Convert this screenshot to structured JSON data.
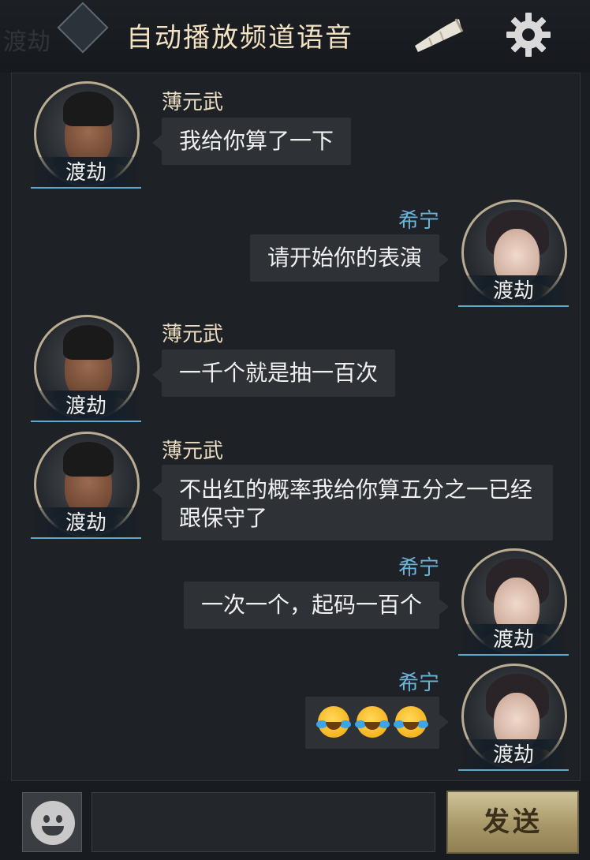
{
  "header": {
    "title": "自动播放频道语音",
    "ghost_left": "渡劫",
    "horn_icon": "horn-icon",
    "settings_icon": "gear-icon"
  },
  "messages": [
    {
      "side": "left",
      "sender": "薄元武",
      "tag": "渡劫",
      "text": "我给你算了一下",
      "avatar": "male"
    },
    {
      "side": "right",
      "sender": "希宁",
      "tag": "渡劫",
      "text": "请开始你的表演",
      "avatar": "female"
    },
    {
      "side": "left",
      "sender": "薄元武",
      "tag": "渡劫",
      "text": "一千个就是抽一百次",
      "avatar": "male"
    },
    {
      "side": "left",
      "sender": "薄元武",
      "tag": "渡劫",
      "text": "不出红的概率我给你算五分之一已经跟保守了",
      "avatar": "male"
    },
    {
      "side": "right",
      "sender": "希宁",
      "tag": "渡劫",
      "text": "一次一个，起码一百个",
      "avatar": "female"
    },
    {
      "side": "right",
      "sender": "希宁",
      "tag": "渡劫",
      "text": "",
      "emoji": "rolling-on-floor-laughing",
      "emoji_count": 3,
      "avatar": "female"
    }
  ],
  "input": {
    "value": "",
    "placeholder": ""
  },
  "send_label": "发送",
  "colors": {
    "title": "#f3e3c3",
    "left_name": "#e9dcc0",
    "right_name": "#6ab4d9",
    "bubble": "#2e3237",
    "tag_underline": "#5fa9c9",
    "send_button": "#b3a374"
  }
}
